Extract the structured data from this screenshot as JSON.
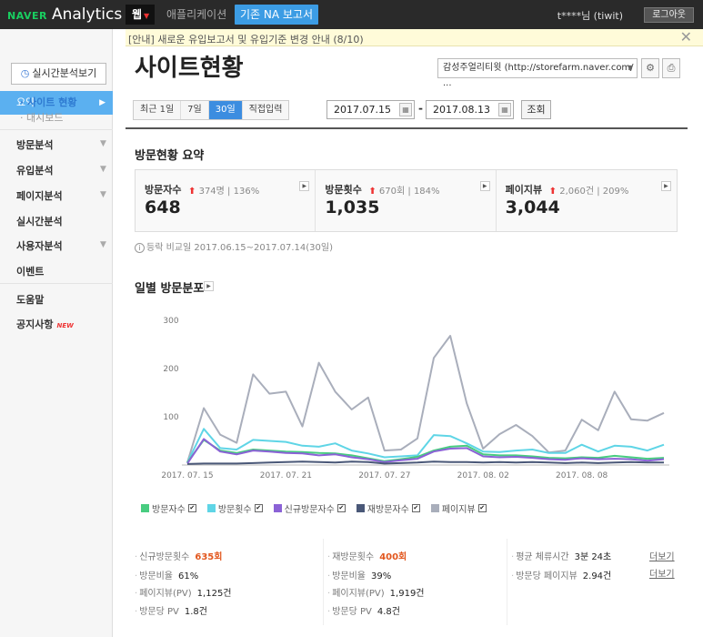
{
  "header": {
    "logo_brand": "NAVER",
    "logo_product": "Analytics",
    "tab_web": "웹",
    "tab_app": "애플리케이션",
    "tab_legacy": "기존 NA 보고서",
    "user": "t****님 (tiwit)",
    "logout": "로그아웃"
  },
  "notice": {
    "text": "[안내] 새로운 유입보고서 및 유입기준 변경 안내 (8/10)",
    "close_icon": "close-icon"
  },
  "sidebar": {
    "realtime_button": "실시간분석보기",
    "active_item": "요약",
    "sub_items": [
      "· 사이트 현황",
      "· 대시보드"
    ],
    "items": [
      "방문분석",
      "유입분석",
      "페이지분석",
      "실시간분석",
      "사용자분석",
      "이벤트",
      "도움말",
      "공지사항"
    ],
    "new_badge": "NEW"
  },
  "page": {
    "title": "사이트현황",
    "site_select": "감성주얼리티윗 (http://storefarm.naver.com/···"
  },
  "period": {
    "buttons": [
      "최근 1일",
      "7일",
      "30일",
      "직접입력"
    ],
    "selected": "30일",
    "start_date": "2017.07.15",
    "end_date": "2017.08.13",
    "query": "조회"
  },
  "summary": {
    "title": "방문현황 요약",
    "cells": [
      {
        "label": "방문자수",
        "delta": "374명",
        "pct": "136%",
        "value": "648"
      },
      {
        "label": "방문횟수",
        "delta": "670회",
        "pct": "184%",
        "value": "1,035"
      },
      {
        "label": "페이지뷰",
        "delta": "2,060건",
        "pct": "209%",
        "value": "3,044"
      }
    ],
    "compare": "등락 비교일  2017.06.15~2017.07.14(30일)"
  },
  "daily": {
    "title": "일별 방문분포"
  },
  "chart_data": {
    "type": "line",
    "title": "",
    "xlabel": "",
    "ylabel": "",
    "ylim": [
      0,
      300
    ],
    "yticks": [
      100,
      200,
      300
    ],
    "grid": false,
    "legend_position": "bottom",
    "x": [
      "2017.07.15",
      "2017.07.16",
      "2017.07.17",
      "2017.07.18",
      "2017.07.19",
      "2017.07.20",
      "2017.07.21",
      "2017.07.22",
      "2017.07.23",
      "2017.07.24",
      "2017.07.25",
      "2017.07.26",
      "2017.07.27",
      "2017.07.28",
      "2017.07.29",
      "2017.07.30",
      "2017.07.31",
      "2017.08.01",
      "2017.08.02",
      "2017.08.03",
      "2017.08.04",
      "2017.08.05",
      "2017.08.06",
      "2017.08.07",
      "2017.08.08",
      "2017.08.09",
      "2017.08.10",
      "2017.08.11",
      "2017.08.12",
      "2017.08.13"
    ],
    "x_tick_labels": [
      "2017. 07. 15",
      "2017. 07. 21",
      "2017. 07. 27",
      "2017. 08. 02",
      "2017. 08. 08"
    ],
    "x_tick_index": [
      0,
      6,
      12,
      18,
      24
    ],
    "series": [
      {
        "name": "방문자수",
        "color": "#48cc80",
        "values": [
          5,
          52,
          30,
          25,
          32,
          30,
          28,
          27,
          25,
          24,
          20,
          14,
          8,
          12,
          17,
          30,
          38,
          40,
          22,
          20,
          20,
          18,
          15,
          14,
          16,
          15,
          19,
          16,
          13,
          15
        ]
      },
      {
        "name": "방문횟수",
        "color": "#5fd5e6",
        "values": [
          5,
          75,
          35,
          32,
          52,
          50,
          48,
          40,
          38,
          45,
          30,
          24,
          16,
          18,
          20,
          62,
          60,
          45,
          28,
          27,
          30,
          32,
          25,
          25,
          42,
          28,
          40,
          38,
          30,
          42
        ]
      },
      {
        "name": "신규방문자수",
        "color": "#8b62d6",
        "values": [
          3,
          54,
          28,
          22,
          30,
          28,
          25,
          24,
          20,
          22,
          16,
          12,
          6,
          10,
          13,
          28,
          34,
          35,
          18,
          16,
          17,
          15,
          12,
          11,
          14,
          12,
          13,
          12,
          9,
          12
        ]
      },
      {
        "name": "재방문자수",
        "color": "#4a5878",
        "values": [
          2,
          3,
          3,
          3,
          4,
          5,
          6,
          7,
          6,
          5,
          7,
          6,
          3,
          4,
          5,
          7,
          6,
          6,
          5,
          6,
          5,
          6,
          5,
          4,
          5,
          4,
          5,
          6,
          5,
          5
        ]
      },
      {
        "name": "페이지뷰",
        "color": "#a9aebb",
        "values": [
          5,
          118,
          63,
          46,
          188,
          148,
          152,
          80,
          212,
          152,
          115,
          140,
          30,
          32,
          55,
          222,
          268,
          128,
          34,
          64,
          83,
          60,
          26,
          30,
          94,
          72,
          152,
          95,
          92,
          108
        ]
      }
    ]
  },
  "stats": {
    "col1": [
      {
        "label": "신규방문횟수",
        "value": "635회",
        "red": true
      },
      {
        "label": "방문비율",
        "value": "61%"
      },
      {
        "label": "페이지뷰(PV)",
        "value": "1,125건"
      },
      {
        "label": "방문당 PV",
        "value": "1.8건"
      }
    ],
    "col2": [
      {
        "label": "재방문횟수",
        "value": "400회",
        "red": true
      },
      {
        "label": "방문비율",
        "value": "39%"
      },
      {
        "label": "페이지뷰(PV)",
        "value": "1,919건"
      },
      {
        "label": "방문당 PV",
        "value": "4.8건"
      }
    ],
    "col3": [
      {
        "label": "평균 체류시간",
        "value": "3분 24초"
      },
      {
        "label": "방문당 페이지뷰",
        "value": "2.94건"
      }
    ],
    "detail_link": "더보기"
  }
}
